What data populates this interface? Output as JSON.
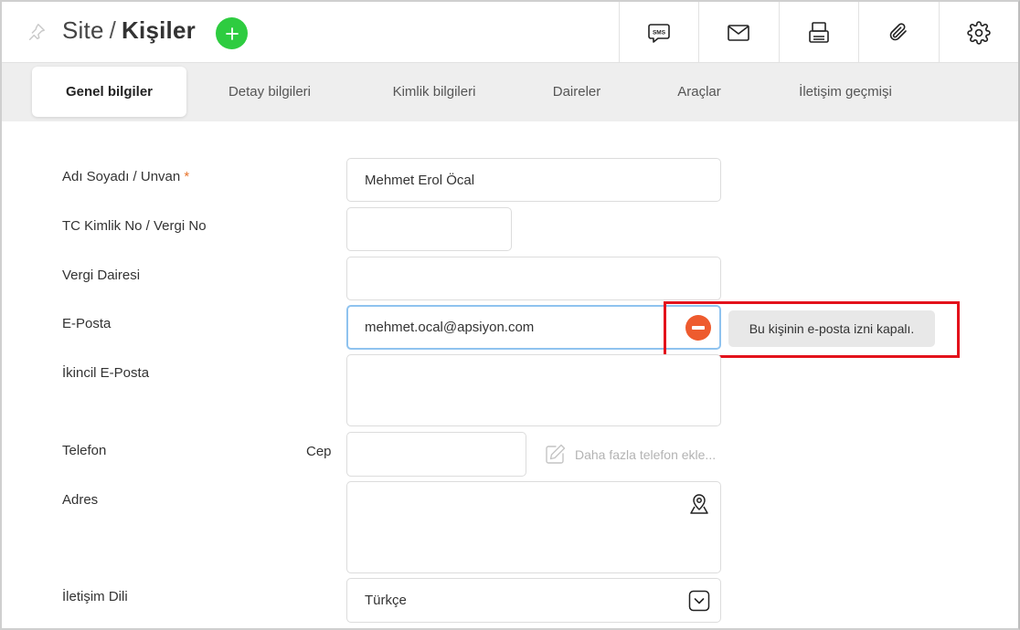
{
  "header": {
    "breadcrumb_root": "Site",
    "separator": "/",
    "page_title": "Kişiler",
    "toolbar": [
      {
        "name": "sms-icon",
        "icon": "sms"
      },
      {
        "name": "mail-icon",
        "icon": "envelope"
      },
      {
        "name": "printer-icon",
        "icon": "printer"
      },
      {
        "name": "paperclip-icon",
        "icon": "paperclip"
      },
      {
        "name": "gear-icon",
        "icon": "gear"
      }
    ],
    "sms_badge": "SMS"
  },
  "tabs": [
    {
      "label": "Genel bilgiler",
      "active": true
    },
    {
      "label": "Detay bilgileri",
      "active": false
    },
    {
      "label": "Kimlik bilgileri",
      "active": false
    },
    {
      "label": "Daireler",
      "active": false
    },
    {
      "label": "Araçlar",
      "active": false
    },
    {
      "label": "İletişim geçmişi",
      "active": false
    }
  ],
  "form": {
    "name": {
      "label": "Adı Soyadı / Unvan",
      "required_mark": "*",
      "value": "Mehmet Erol Öcal"
    },
    "tc": {
      "label": "TC Kimlik No / Vergi No",
      "value": ""
    },
    "tax_office": {
      "label": "Vergi Dairesi",
      "value": ""
    },
    "email": {
      "label": "E-Posta",
      "value": "mehmet.ocal@apsiyon.com"
    },
    "email2": {
      "label": "İkincil E-Posta",
      "value": ""
    },
    "phone": {
      "label": "Telefon",
      "sub_label": "Cep",
      "value": "",
      "more_label": "Daha fazla telefon ekle..."
    },
    "address": {
      "label": "Adres",
      "value": ""
    },
    "language": {
      "label": "İletişim Dili",
      "value": "Türkçe"
    }
  },
  "email_permission": {
    "tooltip": "Bu kişinin e-posta izni kapalı.",
    "status_color": "#ee5b2e",
    "highlight_color": "#e3121b"
  },
  "colors": {
    "accent_green": "#2ecc40",
    "focus_border": "#8fc3ef"
  }
}
